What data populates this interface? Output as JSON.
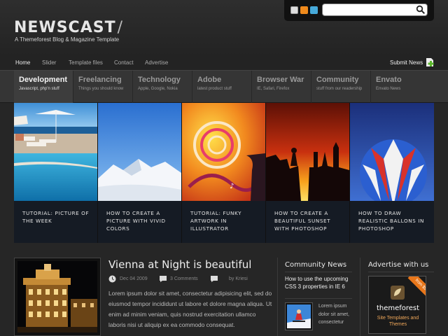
{
  "header": {
    "logo": "NEWSCAST",
    "logo_mark": "/",
    "tagline": "A Themeforest Blog & Magazine Template",
    "search_placeholder": ""
  },
  "nav": {
    "items": [
      "Home",
      "Slider",
      "Template files",
      "Contact",
      "Advertise"
    ],
    "active": "Home",
    "submit": "Submit News"
  },
  "categories": [
    {
      "title": "Development",
      "sub": "Javascript, php'n stuff"
    },
    {
      "title": "Freelancing",
      "sub": "Things you should know"
    },
    {
      "title": "Technology",
      "sub": "Apple, Google, Nokia"
    },
    {
      "title": "Adobe",
      "sub": "latest product stuff"
    },
    {
      "title": "Browser War",
      "sub": "IE, Safari, Firefox"
    },
    {
      "title": "Community",
      "sub": "stuff from our readership"
    },
    {
      "title": "Envato",
      "sub": "Envato News"
    }
  ],
  "slides": [
    {
      "caption": "Tutorial: Picture of the week"
    },
    {
      "caption": "How to create a picture with vivid colors"
    },
    {
      "caption": "Tutorial: Funky artwork in Illustrator"
    },
    {
      "caption": "How to create a beautiful sunset with Photoshop"
    },
    {
      "caption": "How to draw realistic ballons in Photoshop"
    }
  ],
  "article": {
    "title": "Vienna at Night is beautiful",
    "date": "Dec 04 2009",
    "comments": "3 Comments",
    "author": "by Kriesi",
    "excerpt": "Lorem ipsum dolor sit amet, consectetur adipisicing elit, sed do eiusmod tempor incididunt ut labore et dolore magna aliqua. Ut enim ad minim veniam, quis nostrud exercitation ullamco laboris nisi ut aliquip ex ea commodo consequat."
  },
  "community": {
    "title": "Community News",
    "headline": "How to use the upcoming CSS 3 properties in IE 6",
    "text": "Lorem ipsum dolor sit amet, consectetur"
  },
  "advertise": {
    "title": "Advertise with us",
    "tag": "from $5",
    "brand": "themeforest",
    "sub": "Site Templates and Themes"
  }
}
